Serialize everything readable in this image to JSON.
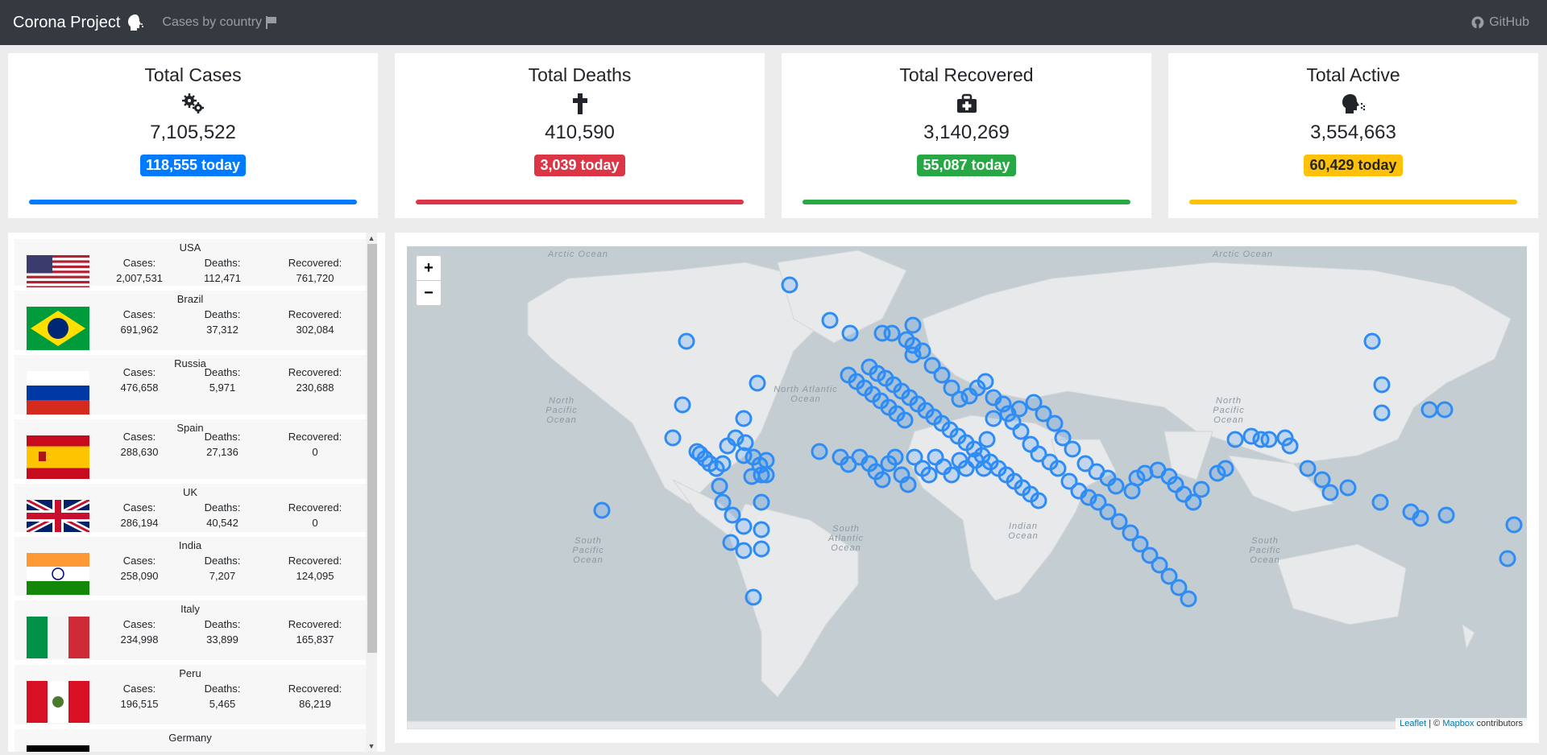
{
  "nav": {
    "brand": "Corona Project",
    "cases_by_country": "Cases by country",
    "github": "GitHub"
  },
  "cards": [
    {
      "title": "Total Cases",
      "value": "7,105,522",
      "today": "118,555 today",
      "color": "#007bff",
      "icon": "virus-gears-icon"
    },
    {
      "title": "Total Deaths",
      "value": "410,590",
      "today": "3,039 today",
      "color": "#dc3545",
      "icon": "cross-icon"
    },
    {
      "title": "Total Recovered",
      "value": "3,140,269",
      "today": "55,087 today",
      "color": "#28a745",
      "icon": "first-aid-kit-icon"
    },
    {
      "title": "Total Active",
      "value": "3,554,663",
      "today": "60,429 today",
      "color": "#ffc107",
      "icon": "coughing-head-icon"
    }
  ],
  "list_labels": {
    "cases": "Cases:",
    "deaths": "Deaths:",
    "recovered": "Recovered:"
  },
  "countries": [
    {
      "name": "USA",
      "cases": "2,007,531",
      "deaths": "112,471",
      "recovered": "761,720"
    },
    {
      "name": "Brazil",
      "cases": "691,962",
      "deaths": "37,312",
      "recovered": "302,084"
    },
    {
      "name": "Russia",
      "cases": "476,658",
      "deaths": "5,971",
      "recovered": "230,688"
    },
    {
      "name": "Spain",
      "cases": "288,630",
      "deaths": "27,136",
      "recovered": "0"
    },
    {
      "name": "UK",
      "cases": "286,194",
      "deaths": "40,542",
      "recovered": "0"
    },
    {
      "name": "India",
      "cases": "258,090",
      "deaths": "7,207",
      "recovered": "124,095"
    },
    {
      "name": "Italy",
      "cases": "234,998",
      "deaths": "33,899",
      "recovered": "165,837"
    },
    {
      "name": "Peru",
      "cases": "196,515",
      "deaths": "5,465",
      "recovered": "86,219"
    },
    {
      "name": "Germany",
      "cases": "",
      "deaths": "",
      "recovered": ""
    }
  ],
  "map": {
    "zoom_in": "+",
    "zoom_out": "−",
    "attribution_leaflet": "Leaflet",
    "attribution_sep": " | © ",
    "attribution_mapbox": "Mapbox",
    "attribution_tail": " contributors",
    "oceans": [
      "Arctic Ocean",
      "North Atlantic Ocean",
      "North Pacific Ocean",
      "South Atlantic Ocean",
      "Indian Ocean",
      "South Pacific Ocean",
      "Arctic Ocean",
      "North Pacific Ocean",
      "South Pacific Ocean"
    ],
    "marker_color": "#2f8cf5"
  }
}
